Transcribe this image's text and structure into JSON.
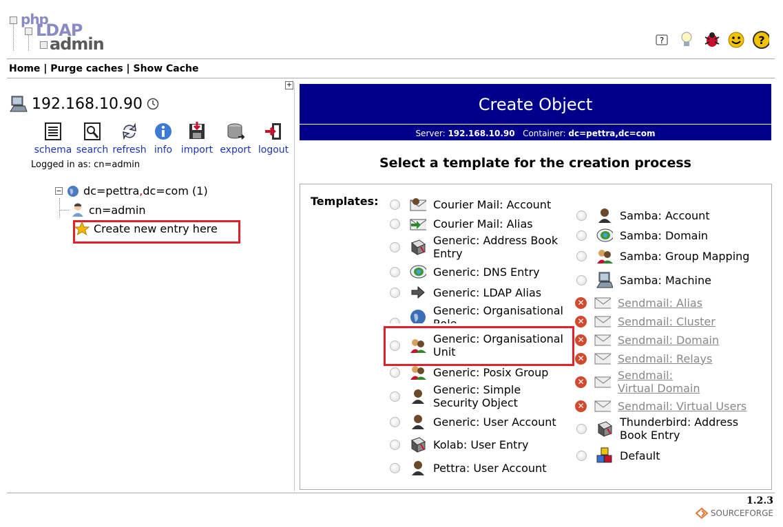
{
  "logo": {
    "line1": "php",
    "line2": "LDAP",
    "line3": "admin"
  },
  "topnav": {
    "home": "Home",
    "sep1": "|",
    "purge": "Purge caches",
    "sep2": "|",
    "cache": "Show Cache"
  },
  "top_icons": [
    "help-icon",
    "lightbulb-icon",
    "bug-icon",
    "smiley-icon",
    "question-icon"
  ],
  "server": {
    "host": "192.168.10.90"
  },
  "tools": [
    {
      "label": "schema",
      "icon": "schema-icon"
    },
    {
      "label": "search",
      "icon": "search-icon"
    },
    {
      "label": "refresh",
      "icon": "refresh-icon"
    },
    {
      "label": "info",
      "icon": "info-icon"
    },
    {
      "label": "import",
      "icon": "import-icon"
    },
    {
      "label": "export",
      "icon": "export-icon"
    },
    {
      "label": "logout",
      "icon": "logout-icon"
    }
  ],
  "logged_in": "Logged in as: cn=admin",
  "tree": {
    "root_part1": "dc=pettra",
    "root_sep": ",",
    "root_part2": "dc=com",
    "root_count": "(1)",
    "child": "cn=admin",
    "create": "Create new entry here"
  },
  "main": {
    "title": "Create Object",
    "server_label": "Server:",
    "server_value": "192.168.10.90",
    "container_label": "Container:",
    "container_value": "dc=pettra,dc=com",
    "section_title": "Select a template for the creation process",
    "templates_label": "Templates:"
  },
  "templates_left": [
    {
      "label": "Courier Mail: Account",
      "icon": "mail-account-icon"
    },
    {
      "label": "Courier Mail: Alias",
      "icon": "mail-alias-icon"
    },
    {
      "label": "Generic: Address Book Entry",
      "icon": "address-book-icon"
    },
    {
      "label": "Generic: DNS Entry",
      "icon": "dns-icon"
    },
    {
      "label": "Generic: LDAP Alias",
      "icon": "arrow-icon"
    },
    {
      "label": "Generic: Organisational Role",
      "icon": "globe-icon"
    },
    {
      "label": "Generic: Organisational Unit",
      "icon": "ou-icon"
    },
    {
      "label": "Generic: Posix Group",
      "icon": "group-icon"
    },
    {
      "label": "Generic: Simple Security Object",
      "icon": "user-icon"
    },
    {
      "label": "Generic: User Account",
      "icon": "user-icon"
    },
    {
      "label": "Kolab: User Entry",
      "icon": "address-book-icon"
    },
    {
      "label": "Pettra: User Account",
      "icon": "user-icon"
    }
  ],
  "templates_right": [
    {
      "label": "Samba: Account",
      "icon": "user-icon",
      "disabled": false
    },
    {
      "label": "Samba: Domain",
      "icon": "dns-icon",
      "disabled": false
    },
    {
      "label": "Samba: Group Mapping",
      "icon": "group-icon",
      "disabled": false
    },
    {
      "label": "Samba: Machine",
      "icon": "computer-icon",
      "disabled": false
    },
    {
      "label": "Sendmail: Alias",
      "icon": "mail-icon",
      "disabled": true
    },
    {
      "label": "Sendmail: Cluster",
      "icon": "mail-icon",
      "disabled": true
    },
    {
      "label": "Sendmail: Domain",
      "icon": "mail-icon",
      "disabled": true
    },
    {
      "label": "Sendmail: Relays",
      "icon": "mail-icon",
      "disabled": true
    },
    {
      "label": "Sendmail: Virtual Domain",
      "icon": "mail-icon",
      "disabled": true
    },
    {
      "label": "Sendmail: Virtual Users",
      "icon": "mail-icon",
      "disabled": true
    },
    {
      "label": "Thunderbird: Address Book Entry",
      "icon": "address-book-icon",
      "disabled": false
    },
    {
      "label": "Default",
      "icon": "blocks-icon",
      "disabled": false
    }
  ],
  "footer": {
    "version": "1.2.3",
    "sourceforge": "SOURCEFORGE"
  },
  "colors": {
    "banner": "#00008b",
    "highlight": "#e0202a",
    "link": "#1a35b0"
  }
}
